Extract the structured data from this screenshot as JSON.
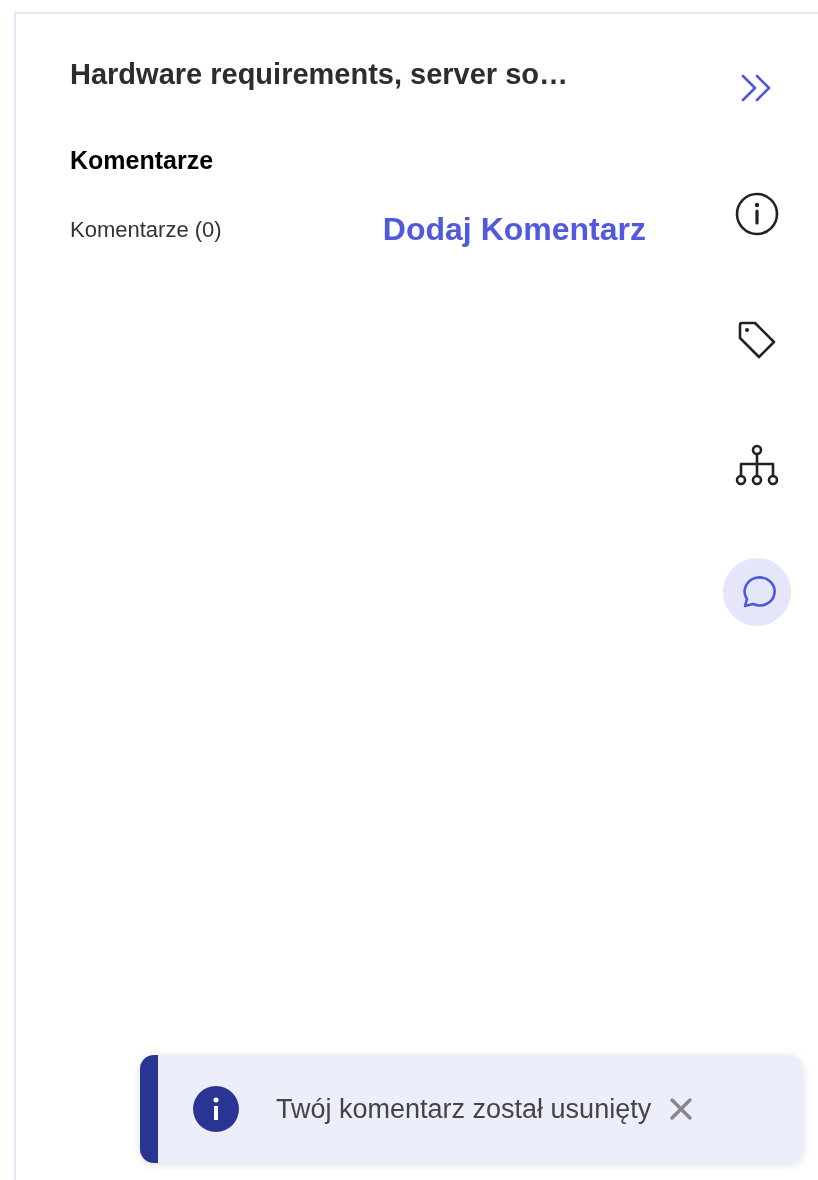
{
  "panel": {
    "title": "Hardware requirements, server so…",
    "section_heading": "Komentarze",
    "comments_count": "Komentarze (0)",
    "add_comment": "Dodaj Komentarz"
  },
  "rail": [
    {
      "kind": "collapse",
      "selected": false
    },
    {
      "kind": "info",
      "selected": false
    },
    {
      "kind": "tag",
      "selected": false
    },
    {
      "kind": "hierarchy",
      "selected": false
    },
    {
      "kind": "comments",
      "selected": true
    }
  ],
  "toast": {
    "message": "Twój komentarz został usunięty"
  }
}
